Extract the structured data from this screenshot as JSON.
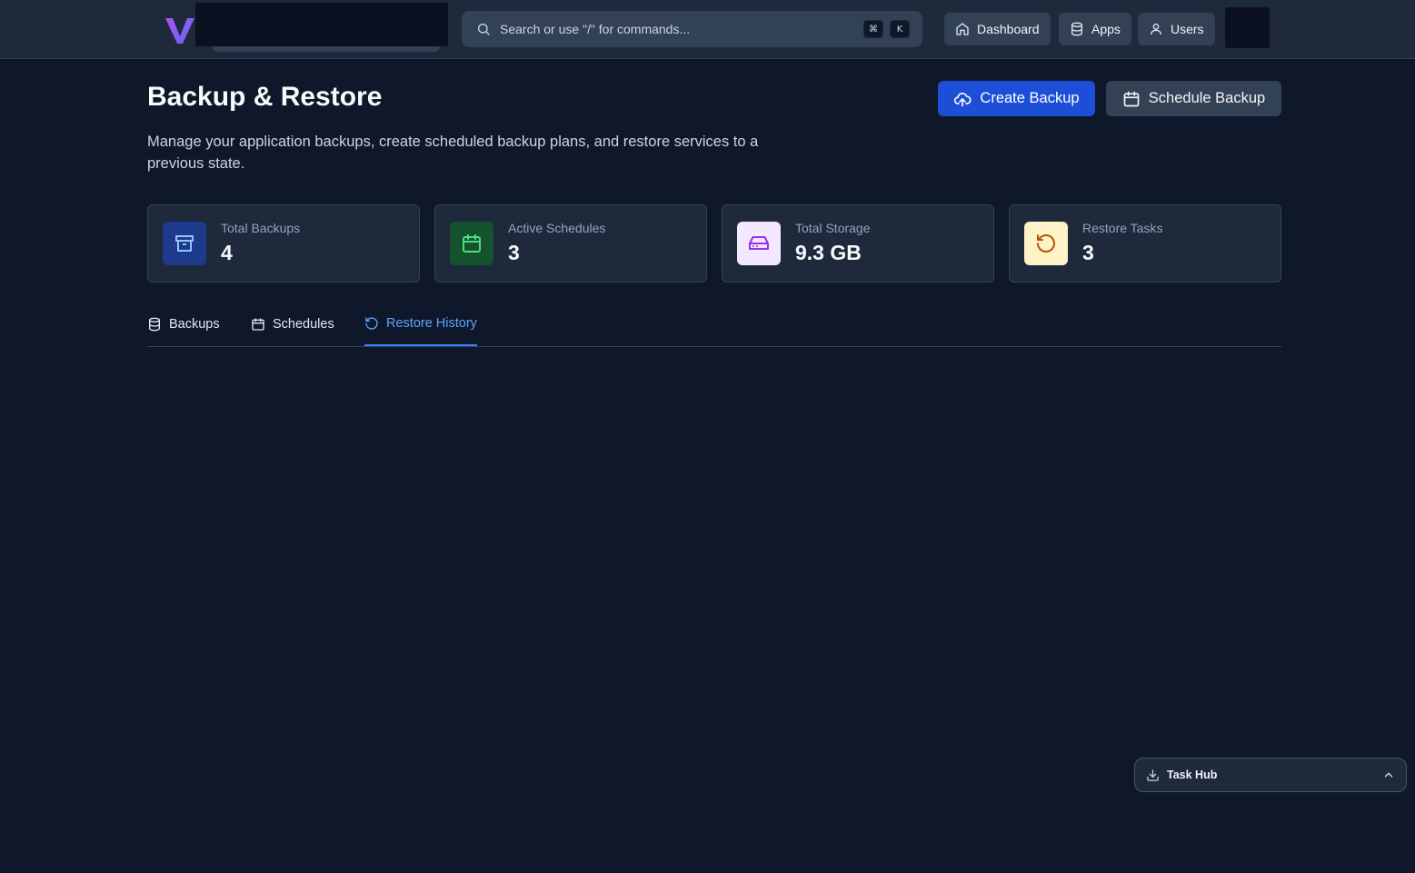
{
  "topbar": {
    "search_placeholder": "Search or use \"/\" for commands...",
    "shortcut_keys": [
      "⌘",
      "K"
    ],
    "nav": [
      {
        "label": "Dashboard",
        "icon": "home-icon"
      },
      {
        "label": "Apps",
        "icon": "database-icon"
      },
      {
        "label": "Users",
        "icon": "user-icon"
      }
    ]
  },
  "header": {
    "title": "Backup & Restore",
    "description": "Manage your application backups, create scheduled backup plans, and restore services to a previous state.",
    "create_label": "Create Backup",
    "schedule_label": "Schedule Backup"
  },
  "stats": [
    {
      "label": "Total Backups",
      "value": "4",
      "icon": "archive-icon",
      "bg": "#1e3a8a",
      "fg": "#93c5fd"
    },
    {
      "label": "Active Schedules",
      "value": "3",
      "icon": "calendar-icon",
      "bg": "#14532d",
      "fg": "#4ade80"
    },
    {
      "label": "Total Storage",
      "value": "9.3 GB",
      "icon": "hard-drive-icon",
      "bg": "#f3e8ff",
      "fg": "#9333ea"
    },
    {
      "label": "Restore Tasks",
      "value": "3",
      "icon": "rotate-ccw-icon",
      "bg": "#fef3c7",
      "fg": "#b45309"
    }
  ],
  "tabs": [
    {
      "label": "Backups",
      "active": false
    },
    {
      "label": "Schedules",
      "active": false
    },
    {
      "label": "Restore History",
      "active": true
    }
  ],
  "task_hub": {
    "label": "Task Hub"
  },
  "colors": {
    "accent": "#3b82f6",
    "background": "#0f172a",
    "surface": "#1e293b"
  }
}
